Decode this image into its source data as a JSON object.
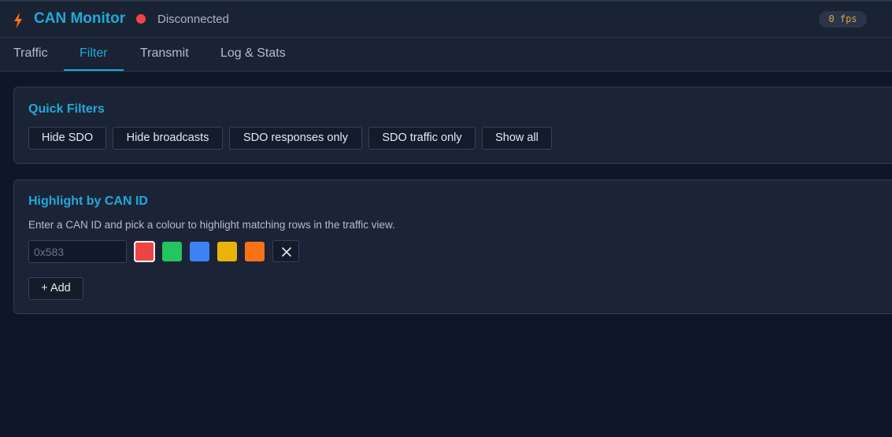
{
  "header": {
    "title": "CAN Monitor",
    "status": "Disconnected",
    "fps": "0 fps",
    "colors": {
      "accent": "#22a8d8",
      "status_dot": "#ef4444",
      "bolt": "#f97316"
    }
  },
  "tabs": [
    {
      "label": "Traffic",
      "active": false
    },
    {
      "label": "Filter",
      "active": true
    },
    {
      "label": "Transmit",
      "active": false
    },
    {
      "label": "Log & Stats",
      "active": false
    }
  ],
  "quick_filters": {
    "title": "Quick Filters",
    "buttons": [
      "Hide SDO",
      "Hide broadcasts",
      "SDO responses only",
      "SDO traffic only",
      "Show all"
    ]
  },
  "highlight": {
    "title": "Highlight by CAN ID",
    "description": "Enter a CAN ID and pick a colour to highlight matching rows in the traffic view.",
    "input_placeholder": "0x583",
    "colors": [
      "#ef4444",
      "#22c55e",
      "#3b82f6",
      "#eab308",
      "#f97316"
    ],
    "selected_color": "#ef4444",
    "clear_icon": "close-icon",
    "add_label": "+ Add"
  }
}
